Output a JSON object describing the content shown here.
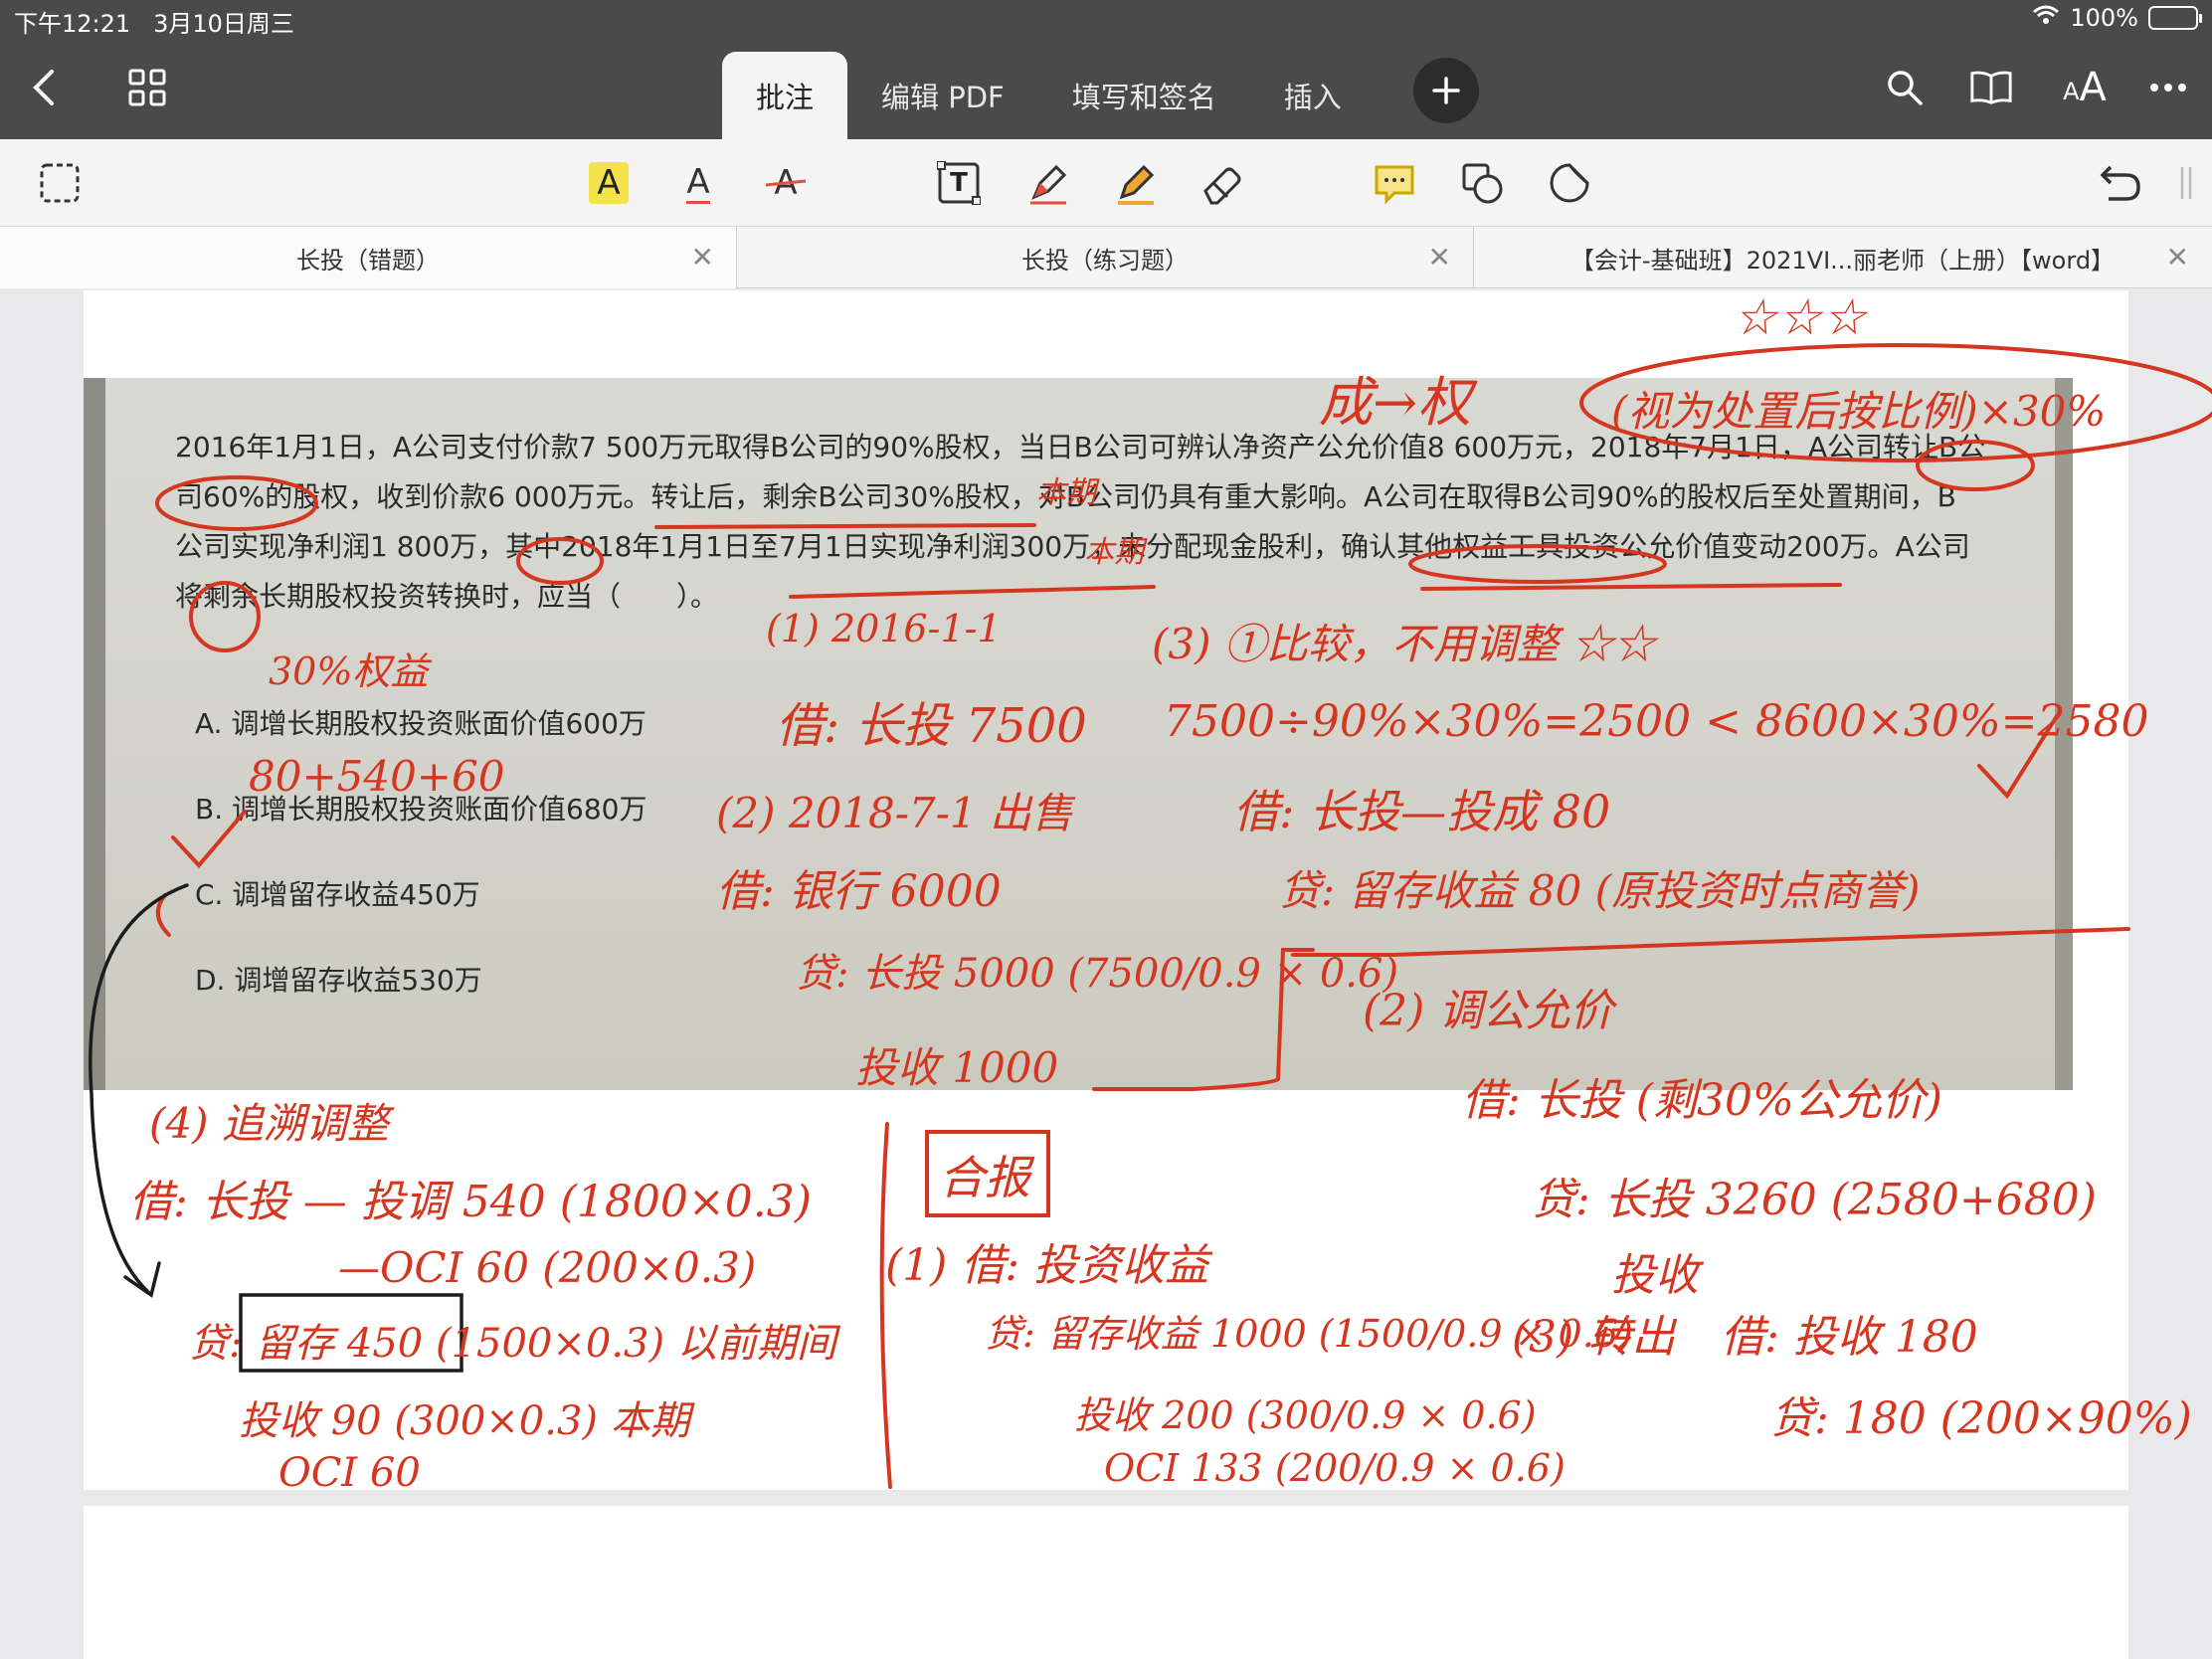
{
  "status": {
    "time": "下午12:21",
    "date": "3月10日周三",
    "battery": "100%",
    "battery_level": 1.0
  },
  "nav": {
    "tabs": [
      "批注",
      "编辑 PDF",
      "填写和签名",
      "插入"
    ],
    "active_tab": 0,
    "text_size_label": "AA"
  },
  "toolbar": {
    "highlight_text": "A",
    "underline_text": "A",
    "strike_text": "A",
    "textbox_text": "T"
  },
  "doc_tabs": [
    "长投（错题）",
    "长投（练习题）",
    "【会计-基础班】2021VI...丽老师（上册）【word】"
  ],
  "question": {
    "lines": [
      "2016年1月1日，A公司支付价款7 500万元取得B公司的90%股权，当日B公司可辨认净资产公允价值8 600万元，2018年7月1日，A公司转让B公",
      "司60%的股权，收到价款6 000万元。转让后，剩余B公司30%股权，对B公司仍具有重大影响。A公司在取得B公司90%的股权后至处置期间，B",
      "公司实现净利润1 800万，其中2018年1月1日至7月1日实现净利润300万，未分配现金股利，确认其他权益工具投资公允价值变动200万。A公司",
      "将剩余长期股权投资转换时，应当（　　）。"
    ],
    "options": [
      "A. 调增长期股权投资账面价值600万",
      "B. 调增长期股权投资账面价值680万",
      "C. 调增留存收益450万",
      "D. 调增留存收益530万"
    ]
  },
  "handwriting": {
    "top_title": "成→权",
    "top_stars": "☆☆☆",
    "top_note": "(视为处置后按比例)×30%",
    "annot_30": "30%权益",
    "annot_land": "本期",
    "annot_mid": "本期",
    "optb_note": "80+540+60",
    "s1_head": "(1) 2016-1-1",
    "s1_entry": "借: 长投 7500",
    "s2_head": "(2) 2018-7-1 出售",
    "s2_debit": "借: 银行 6000",
    "s2_credit": "贷: 长投 5000 (7500/0.9 × 0.6)",
    "s2_credit2": "投收 1000",
    "s3_head": "(3) ①比较，不用调整 ☆☆",
    "s3_calc": "7500÷90%×30%=2500 < 8600×30%=2580",
    "s3_debit": "借: 长投—投成 80",
    "s3_credit": "贷: 留存收益 80 (原投资时点商誉)",
    "s4_head": "(4) 追溯调整",
    "s4_debit": "借: 长投 — 投调 540 (1800×0.3)",
    "s4_oci": "—OCI 60 (200×0.3)",
    "s4_credit": "贷: 留存 450 (1500×0.3) 以前期间",
    "s4_credit2": "投收 90 (300×0.3) 本期",
    "s4_credit3": "OCI 60",
    "rev_head": "(2) 调公允价",
    "rev_debit": "借: 长投 (剩30%公允价)",
    "rev_credit": "贷: 长投 3260 (2580+680)",
    "rev_credit2": "投收",
    "rev_3": "(3) 转出",
    "rev_3_debit": "借: 投收 180",
    "rev_3_credit": "贷: 180 (200×90%)",
    "cons_box": "合报",
    "cons_1": "(1) 借: 投资收益",
    "cons_2": "贷: 留存收益 1000 (1500/0.9 × 0.6)",
    "cons_3": "投收 200 (300/0.9 × 0.6)",
    "cons_4": "OCI 133 (200/0.9 × 0.6)"
  },
  "colors": {
    "ink_red": "#d4361f",
    "toolbar_dark": "#4a4a4a",
    "highlight_yellow": "#f3e249"
  }
}
